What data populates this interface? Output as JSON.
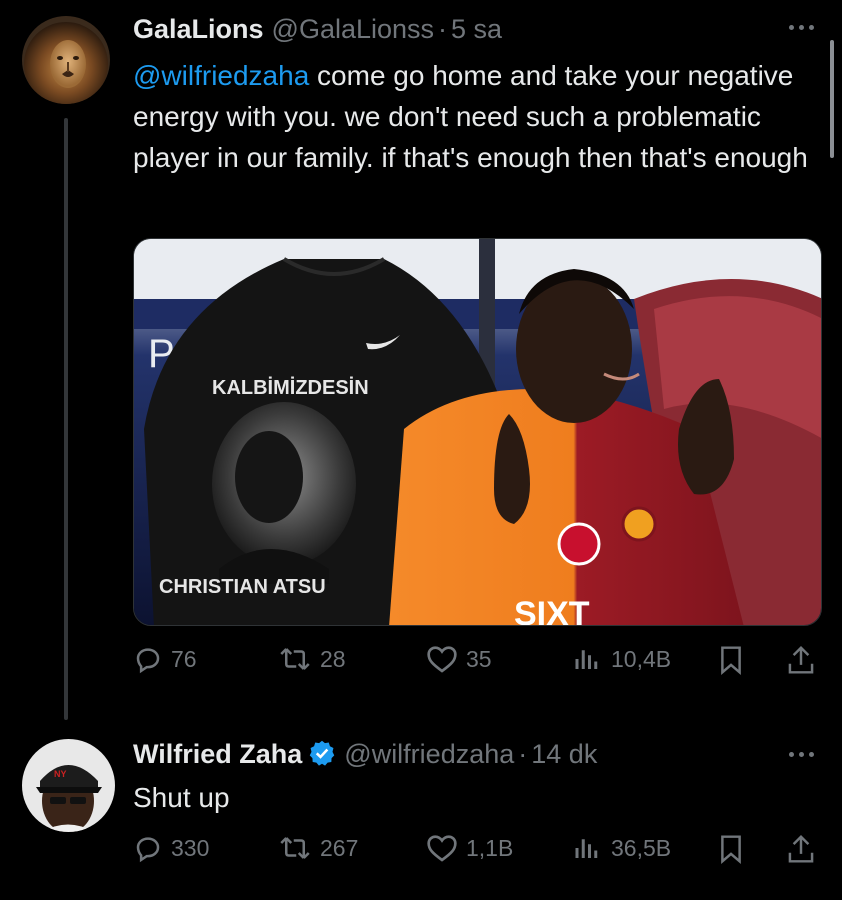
{
  "tweets": [
    {
      "display_name": "GalaLions",
      "handle": "@GalaLionss",
      "separator": "·",
      "time": "5 sa",
      "mention": "@wilfriedzaha",
      "text": " come go home and take your negative energy with you. we don't need such a problematic player in our family. if that's enough then that's enough",
      "media": {
        "shirt_top_text": "KALBİMİZDESİN",
        "shirt_bottom_text": "CHRISTIAN ATSU",
        "banner_letter": "P",
        "sponsor_text": "SIXT"
      },
      "stats": {
        "replies": "76",
        "retweets": "28",
        "likes": "35",
        "views": "10,4B"
      },
      "icons": [
        "reply-icon",
        "retweet-icon",
        "like-icon",
        "views-icon",
        "bookmark-icon",
        "share-icon",
        "more-icon"
      ]
    },
    {
      "display_name": "Wilfried Zaha",
      "handle": "@wilfriedzaha",
      "separator": "·",
      "time": "14 dk",
      "text": "Shut up",
      "verified": true,
      "stats": {
        "replies": "330",
        "retweets": "267",
        "likes": "1,1B",
        "views": "36,5B"
      }
    }
  ],
  "colors": {
    "background": "#000000",
    "text": "#e7e9ea",
    "muted": "#71767b",
    "link": "#1d9bf0",
    "verified": "#1d9bf0"
  }
}
